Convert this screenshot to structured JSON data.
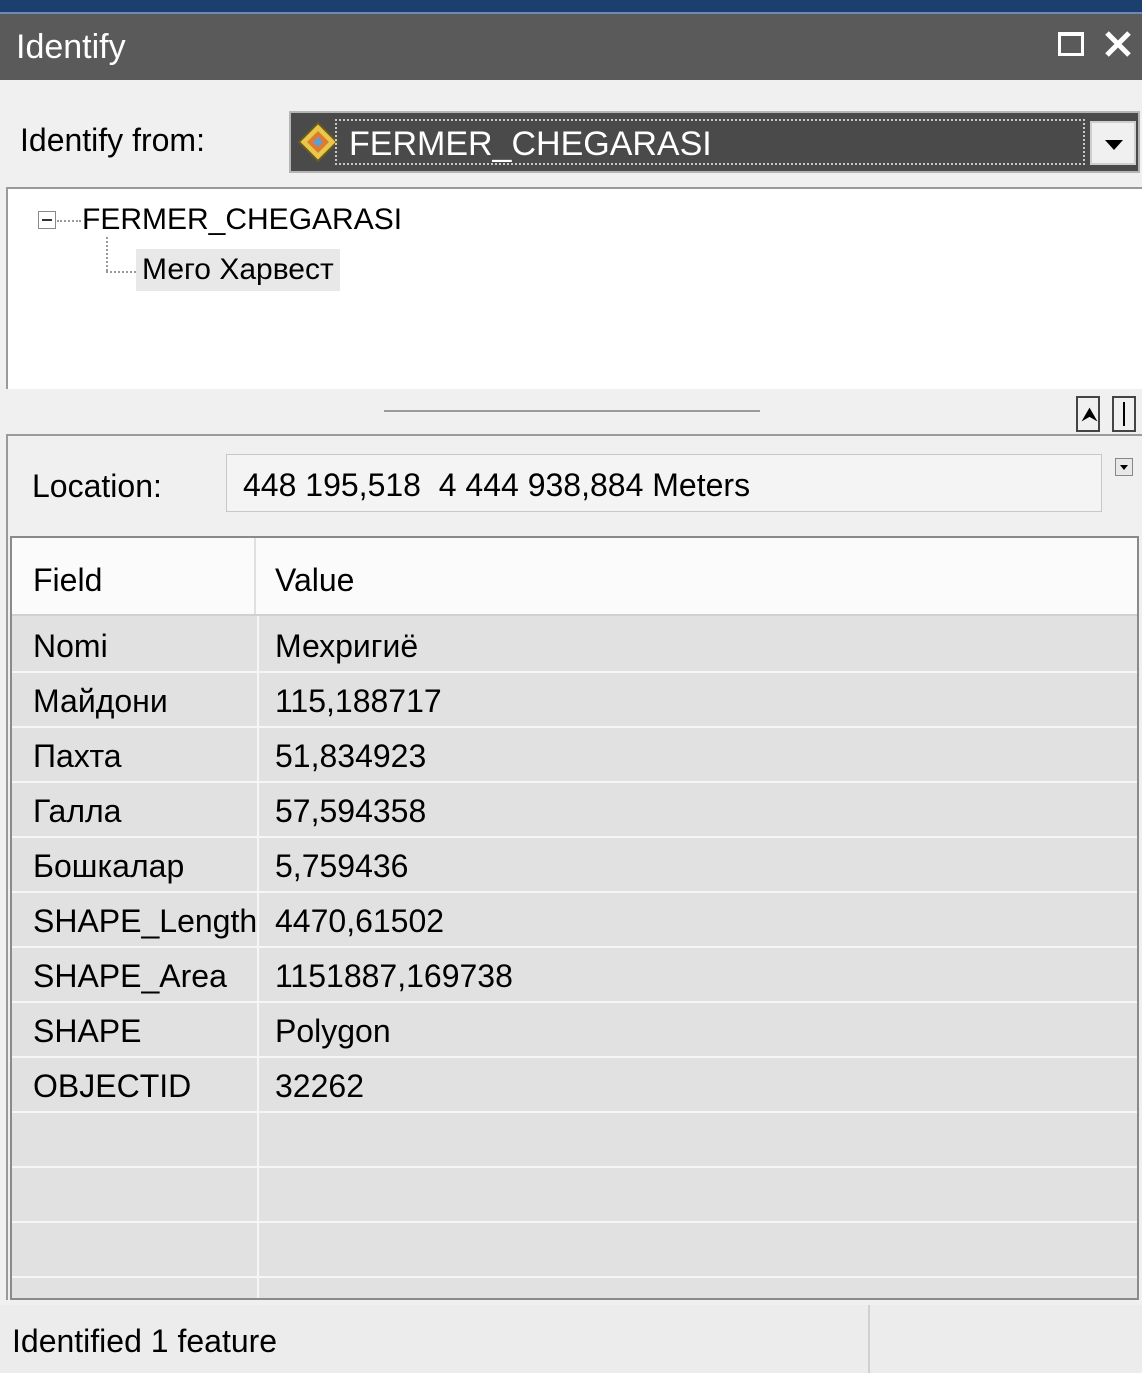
{
  "window": {
    "title": "Identify",
    "maximize_icon": "maximize-icon",
    "close_icon": "close-icon"
  },
  "identify_from": {
    "label": "Identify from:",
    "selected": "FERMER_CHEGARASI",
    "layer_icon": "layer-diamond-icon"
  },
  "tree": {
    "root": "FERMER_CHEGARASI",
    "child": "Мего Харвест"
  },
  "location": {
    "label": "Location:",
    "value": "448 195,518  4 444 938,884 Meters"
  },
  "table": {
    "headers": {
      "field": "Field",
      "value": "Value"
    },
    "rows": [
      {
        "field": "Nomi",
        "value": "Мехригиё"
      },
      {
        "field": "Майдони",
        "value": "115,188717"
      },
      {
        "field": "Пахта",
        "value": "51,834923"
      },
      {
        "field": "Галла",
        "value": "57,594358"
      },
      {
        "field": "Бошкалар",
        "value": "5,759436"
      },
      {
        "field": "SHAPE_Length",
        "value": "4470,61502"
      },
      {
        "field": "SHAPE_Area",
        "value": "1151887,169738"
      },
      {
        "field": "SHAPE",
        "value": "Polygon"
      },
      {
        "field": "OBJECTID",
        "value": "32262"
      }
    ]
  },
  "status": {
    "text": "Identified 1 feature"
  },
  "colors": {
    "titlebar": "#5a5a5a",
    "select_background": "#4a4a4a",
    "grid_background": "#e1e1e1"
  }
}
